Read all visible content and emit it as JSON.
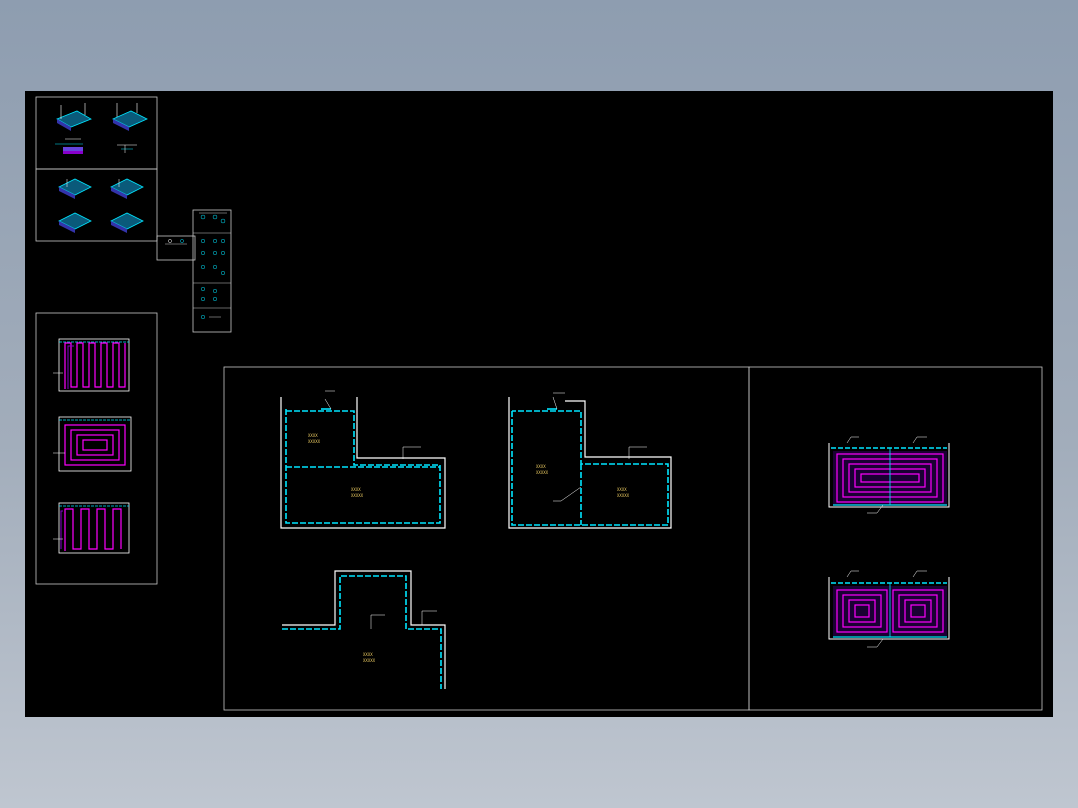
{
  "drawing": {
    "background": "#000000",
    "colors": {
      "frame": "#c8c8c8",
      "wall": "#ffffff",
      "insulation": "#00e5ff",
      "heating_pipe": "#ff00ff",
      "pipe_fill": "#8800cc",
      "label": "#e8c860"
    },
    "floor_plans": {
      "room_labels": [
        "XXXX",
        "XXXXX"
      ]
    }
  }
}
